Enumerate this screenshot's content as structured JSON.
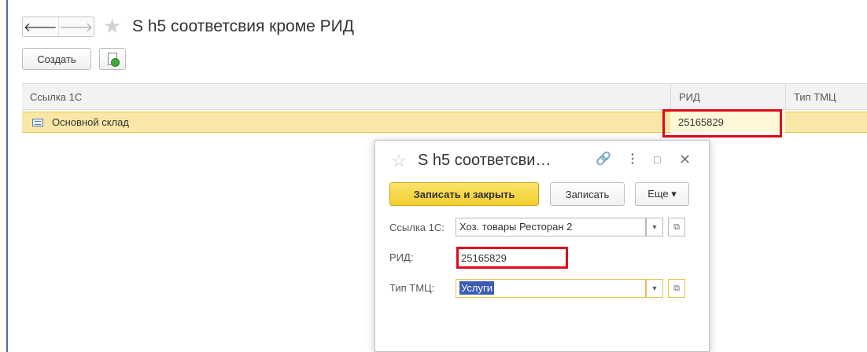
{
  "nav": {
    "back_icon": "arrow-left-icon",
    "forward_icon": "arrow-right-icon",
    "back_glyph": "🡐",
    "forward_glyph": "🡒",
    "favorite_glyph": "★"
  },
  "page": {
    "title": "S h5 соответсвия кроме РИД"
  },
  "toolbar": {
    "create_label": "Создать",
    "add_copy_icon": "document-add-icon"
  },
  "table": {
    "columns": [
      "Ссылка 1С",
      "РИД",
      "Тип ТМЦ"
    ],
    "rows": [
      {
        "name": "Основной склад",
        "rid": "25165829",
        "type": ""
      }
    ]
  },
  "dialog": {
    "title": "S h5 соответсви…",
    "star_glyph": "☆",
    "link_glyph": "🔗",
    "more_glyph": "⋮",
    "maximize_glyph": "□",
    "close_glyph": "✕",
    "save_close_label": "Записать и закрыть",
    "save_label": "Записать",
    "more_label": "Еще ▾",
    "fields": {
      "link_label": "Ссылка 1С:",
      "link_value": "Хоз. товары Ресторан 2",
      "rid_label": "РИД:",
      "rid_value": "25165829",
      "type_label": "Тип ТМЦ:",
      "type_value": "Услуги"
    },
    "dropdown_glyph": "▼",
    "open_glyph": "⧉"
  },
  "colors": {
    "accent_yellow": "#f2cd2e",
    "row_highlight": "#f8e7a6",
    "annotation_red": "#e0061b",
    "frame_blue": "#4a6fa5"
  }
}
